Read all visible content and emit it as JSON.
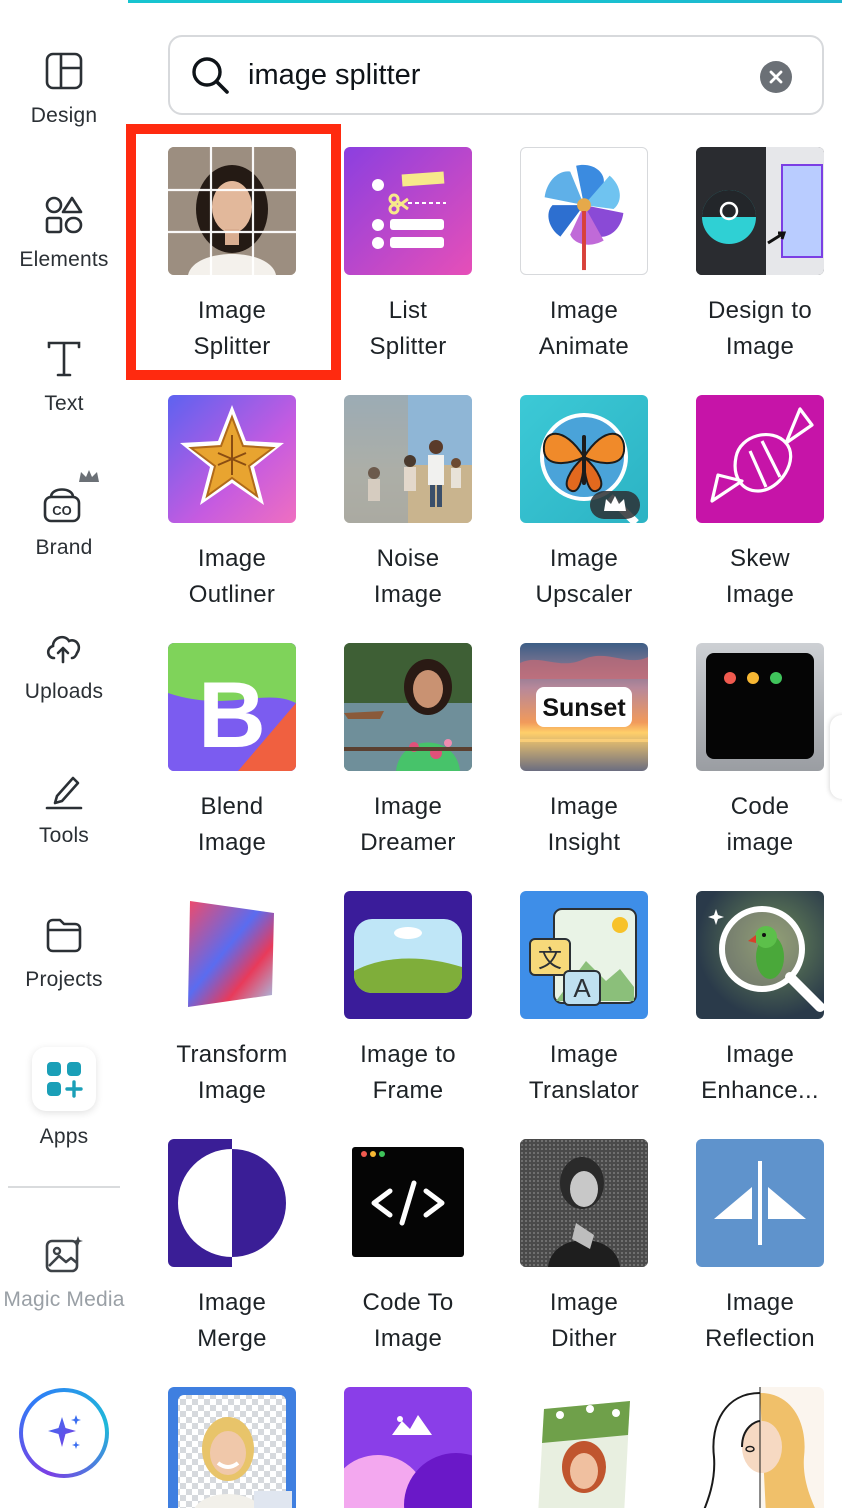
{
  "search": {
    "value": "image splitter",
    "placeholder": "Search"
  },
  "sidebar": {
    "items": [
      {
        "label": "Design",
        "icon": "design-layout-icon"
      },
      {
        "label": "Elements",
        "icon": "shapes-icon"
      },
      {
        "label": "Text",
        "icon": "text-t-icon"
      },
      {
        "label": "Brand",
        "icon": "brand-kit-icon"
      },
      {
        "label": "Uploads",
        "icon": "cloud-upload-icon"
      },
      {
        "label": "Tools",
        "icon": "pen-tool-icon"
      },
      {
        "label": "Projects",
        "icon": "folder-icon"
      },
      {
        "label": "Apps",
        "icon": "apps-grid-icon"
      },
      {
        "label": "Magic Media",
        "icon": "magic-image-icon"
      }
    ],
    "assistant_icon": "sparkle-icon"
  },
  "apps": [
    {
      "line1": "Image",
      "line2": "Splitter"
    },
    {
      "line1": "List",
      "line2": "Splitter"
    },
    {
      "line1": "Image",
      "line2": "Animate"
    },
    {
      "line1": "Design to",
      "line2": "Image"
    },
    {
      "line1": "Image",
      "line2": "Outliner"
    },
    {
      "line1": "Noise",
      "line2": "Image"
    },
    {
      "line1": "Image",
      "line2": "Upscaler"
    },
    {
      "line1": "Skew",
      "line2": "Image"
    },
    {
      "line1": "Blend",
      "line2": "Image"
    },
    {
      "line1": "Image",
      "line2": "Dreamer"
    },
    {
      "line1": "Image",
      "line2": "Insight"
    },
    {
      "line1": "Code",
      "line2": "image"
    },
    {
      "line1": "Transform",
      "line2": "Image"
    },
    {
      "line1": "Image to",
      "line2": "Frame"
    },
    {
      "line1": "Image",
      "line2": "Translator"
    },
    {
      "line1": "Image",
      "line2": "Enhance..."
    },
    {
      "line1": "Image",
      "line2": "Merge"
    },
    {
      "line1": "Code To",
      "line2": "Image"
    },
    {
      "line1": "Image",
      "line2": "Dither"
    },
    {
      "line1": "Image",
      "line2": "Reflection"
    }
  ],
  "thumb_text": {
    "sunset": "Sunset",
    "translate_glyph": "文",
    "translate_letter": "A",
    "blend_letter": "B"
  },
  "colors": {
    "highlight": "#ff2a0f",
    "accent": "#17c4d0",
    "brand_purple": "#7b3fe4"
  }
}
